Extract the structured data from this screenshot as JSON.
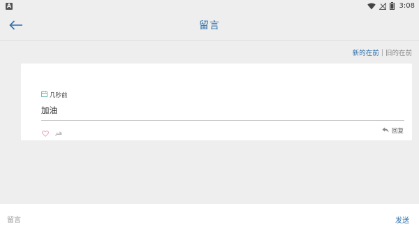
{
  "status_bar": {
    "left_badge": "A",
    "time": "3:08",
    "icons": [
      "wifi-icon",
      "signal-off-icon",
      "battery-icon"
    ]
  },
  "app_bar": {
    "back_icon": "arrow-left-icon",
    "title": "留言"
  },
  "sort": {
    "newest_label": "新的在前",
    "separator": "|",
    "oldest_label": "旧的在前",
    "active": "newest"
  },
  "comments": [
    {
      "time_icon": "calendar-icon",
      "time": "几秒前",
      "text": "加油",
      "like_icon": "heart-outline-icon",
      "like_name": "هم",
      "reply_icon": "reply-icon",
      "reply_label": "回复"
    }
  ],
  "composer": {
    "placeholder": "留言",
    "value": "",
    "send_label": "发送"
  },
  "colors": {
    "accent": "#2e6ea8",
    "background": "#eeeeee",
    "card": "#ffffff",
    "like_heart": "#e8a0ad"
  }
}
